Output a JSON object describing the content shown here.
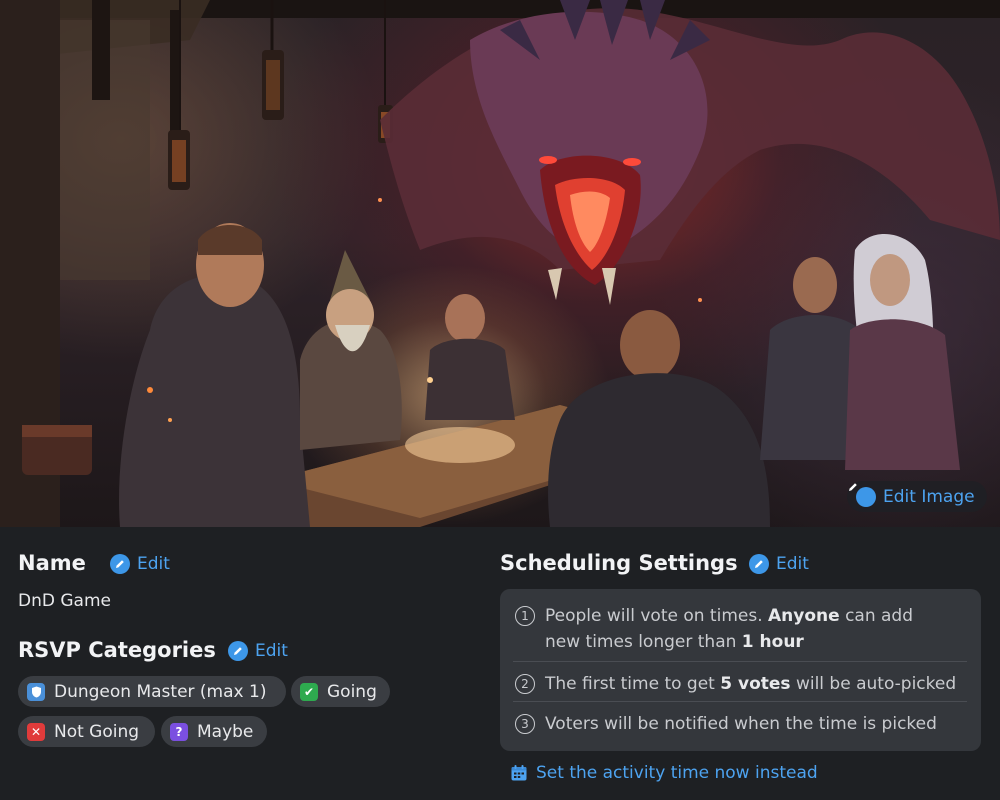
{
  "hero": {
    "edit_image_label": "Edit Image"
  },
  "name_section": {
    "title": "Name",
    "edit_label": "Edit",
    "value": "DnD Game"
  },
  "rsvp_section": {
    "title": "RSVP Categories",
    "edit_label": "Edit",
    "categories": [
      {
        "label": "Dungeon Master (max 1)",
        "icon": "shield-icon",
        "color": "#4a90d9"
      },
      {
        "label": "Going",
        "icon": "check-icon",
        "color": "#2eaa4f"
      },
      {
        "label": "Not Going",
        "icon": "x-icon",
        "color": "#e03b3b"
      },
      {
        "label": "Maybe",
        "icon": "question-icon",
        "color": "#7b4fe0"
      }
    ]
  },
  "scheduling": {
    "title": "Scheduling Settings",
    "edit_label": "Edit",
    "rules": [
      {
        "number": "1",
        "line1_prefix": "People will vote on times. ",
        "line1_bold": "Anyone",
        "line1_suffix": " can add",
        "line2_prefix": "new times longer than ",
        "line2_bold": "1 hour"
      },
      {
        "number": "2",
        "prefix": "The first time to get ",
        "bold": "5 votes",
        "suffix": " will be auto-picked"
      },
      {
        "number": "3",
        "text": "Voters will be notified when the time is picked"
      }
    ],
    "set_now_label": "Set the activity time now instead"
  },
  "colors": {
    "accent": "#4da3f0",
    "background": "#1e2023",
    "panel": "#34373c"
  }
}
